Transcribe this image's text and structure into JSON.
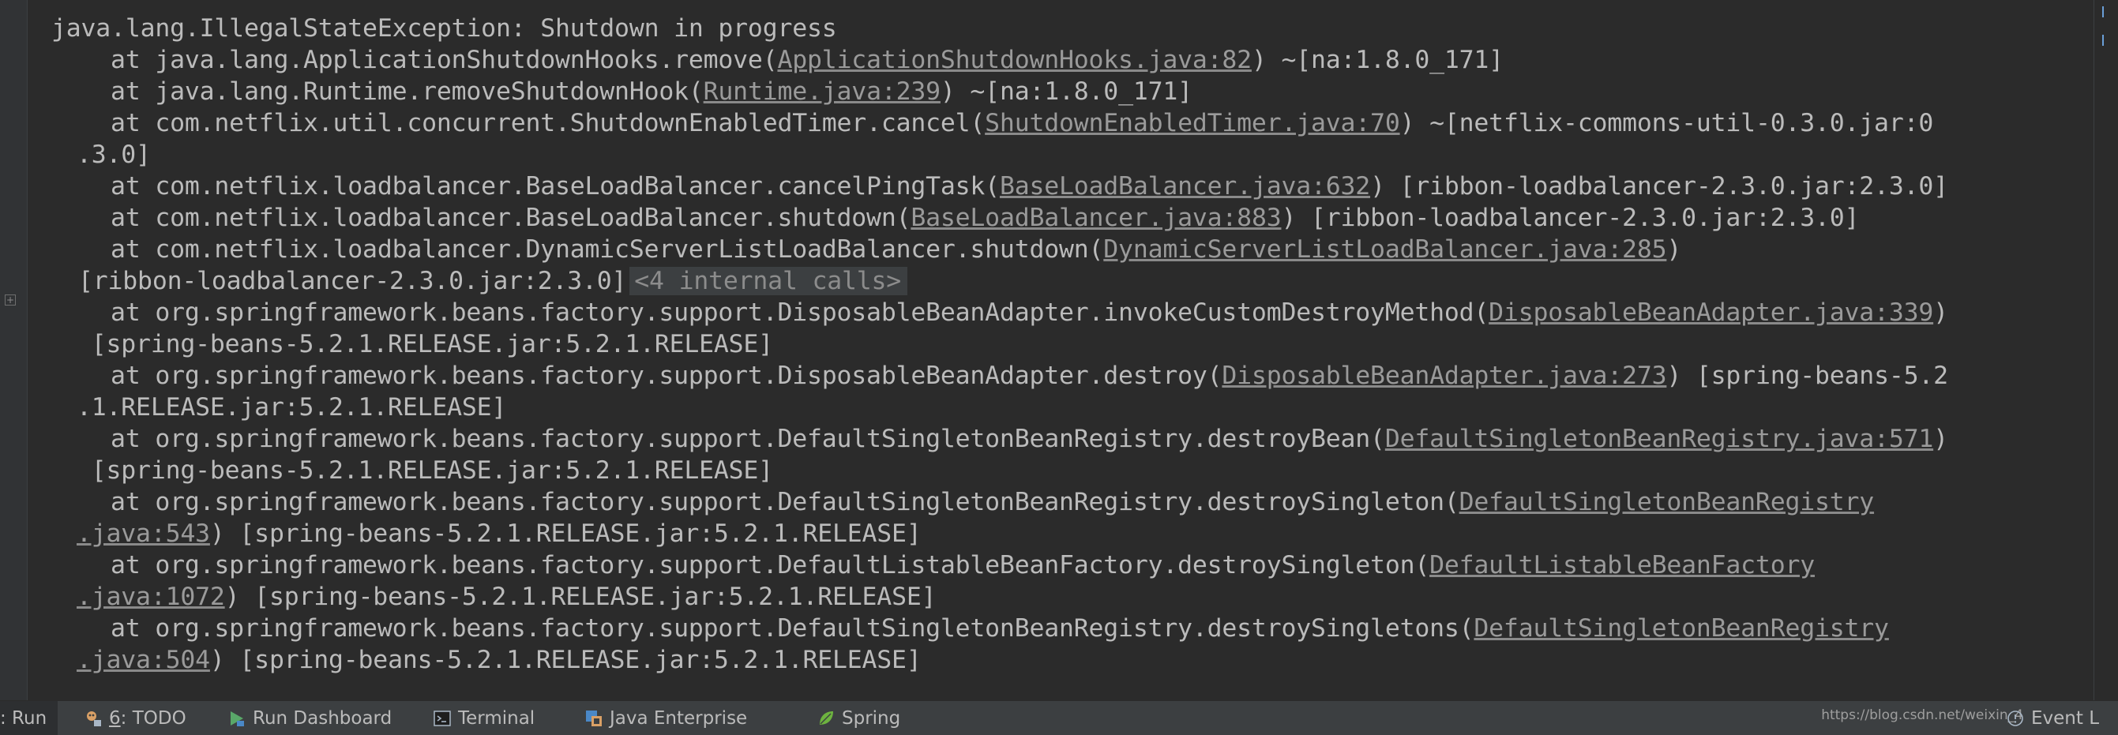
{
  "console": {
    "lines": [
      {
        "kind": "header",
        "text": "java.lang.IllegalStateException: Shutdown in progress"
      },
      {
        "kind": "frame",
        "pre": "    at java.lang.ApplicationShutdownHooks.remove(",
        "link": "ApplicationShutdownHooks.java:82",
        "post": ") ~[na:1.8.0_171]"
      },
      {
        "kind": "frame",
        "pre": "    at java.lang.Runtime.removeShutdownHook(",
        "link": "Runtime.java:239",
        "post": ") ~[na:1.8.0_171]"
      },
      {
        "kind": "frame",
        "pre": "    at com.netflix.util.concurrent.ShutdownEnabledTimer.cancel(",
        "link": "ShutdownEnabledTimer.java:70",
        "post": ") ~[netflix-commons-util-0.3.0.jar:0"
      },
      {
        "kind": "wrap",
        "text": ".3.0]"
      },
      {
        "kind": "frame",
        "pre": "    at com.netflix.loadbalancer.BaseLoadBalancer.cancelPingTask(",
        "link": "BaseLoadBalancer.java:632",
        "post": ") [ribbon-loadbalancer-2.3.0.jar:2.3.0]"
      },
      {
        "kind": "frame",
        "pre": "    at com.netflix.loadbalancer.BaseLoadBalancer.shutdown(",
        "link": "BaseLoadBalancer.java:883",
        "post": ") [ribbon-loadbalancer-2.3.0.jar:2.3.0]"
      },
      {
        "kind": "frame",
        "pre": "    at com.netflix.loadbalancer.DynamicServerListLoadBalancer.shutdown(",
        "link": "DynamicServerListLoadBalancer.java:285",
        "post": ")"
      },
      {
        "kind": "folded",
        "text": "[ribbon-loadbalancer-2.3.0.jar:2.3.0]",
        "internal": "<4 internal calls>"
      },
      {
        "kind": "frame",
        "pre": "    at org.springframework.beans.factory.support.DisposableBeanAdapter.invokeCustomDestroyMethod(",
        "link": "DisposableBeanAdapter.java:339",
        "post": ")"
      },
      {
        "kind": "wrap",
        "text": " [spring-beans-5.2.1.RELEASE.jar:5.2.1.RELEASE]"
      },
      {
        "kind": "frame",
        "pre": "    at org.springframework.beans.factory.support.DisposableBeanAdapter.destroy(",
        "link": "DisposableBeanAdapter.java:273",
        "post": ") [spring-beans-5.2"
      },
      {
        "kind": "wrap",
        "text": ".1.RELEASE.jar:5.2.1.RELEASE]"
      },
      {
        "kind": "frame",
        "pre": "    at org.springframework.beans.factory.support.DefaultSingletonBeanRegistry.destroyBean(",
        "link": "DefaultSingletonBeanRegistry.java:571",
        "post": ")"
      },
      {
        "kind": "wrap",
        "text": " [spring-beans-5.2.1.RELEASE.jar:5.2.1.RELEASE]"
      },
      {
        "kind": "frame",
        "pre": "    at org.springframework.beans.factory.support.DefaultSingletonBeanRegistry.destroySingleton(",
        "link": "DefaultSingletonBeanRegistry",
        "post": ""
      },
      {
        "kind": "wraplink",
        "link": ".java:543",
        "post": ") [spring-beans-5.2.1.RELEASE.jar:5.2.1.RELEASE]"
      },
      {
        "kind": "frame",
        "pre": "    at org.springframework.beans.factory.support.DefaultListableBeanFactory.destroySingleton(",
        "link": "DefaultListableBeanFactory",
        "post": ""
      },
      {
        "kind": "wraplink",
        "link": ".java:1072",
        "post": ") [spring-beans-5.2.1.RELEASE.jar:5.2.1.RELEASE]"
      },
      {
        "kind": "frame",
        "pre": "    at org.springframework.beans.factory.support.DefaultSingletonBeanRegistry.destroySingletons(",
        "link": "DefaultSingletonBeanRegistry",
        "post": ""
      },
      {
        "kind": "wraplink",
        "link": ".java:504",
        "post": ") [spring-beans-5.2.1.RELEASE.jar:5.2.1.RELEASE]"
      }
    ]
  },
  "toolbar": {
    "run_label": ": Run",
    "todo_number": "6",
    "todo_label": ": TODO",
    "run_dashboard_label": "Run Dashboard",
    "terminal_label": "Terminal",
    "java_enterprise_label": "Java Enterprise",
    "spring_label": "Spring",
    "event_log_label": "Event L",
    "watermark": "https://blog.csdn.net/weixin_4"
  },
  "colors": {
    "background": "#2b2b2b",
    "text": "#bbbbbb",
    "link": "#9a9a9a",
    "toolbar": "#3c3f41"
  }
}
